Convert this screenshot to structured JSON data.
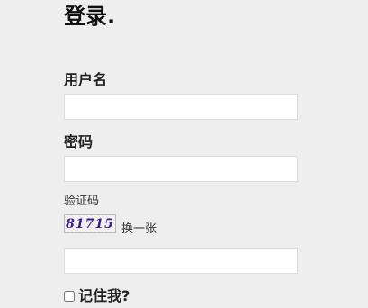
{
  "form": {
    "title": "登录.",
    "username_label": "用户名",
    "username_value": "",
    "password_label": "密码",
    "password_value": "",
    "captcha_label": "验证码",
    "captcha_image_text": "81715",
    "captcha_refresh_label": "换一张",
    "captcha_value": "",
    "remember_label": "记住我?",
    "remember_checked": false
  }
}
